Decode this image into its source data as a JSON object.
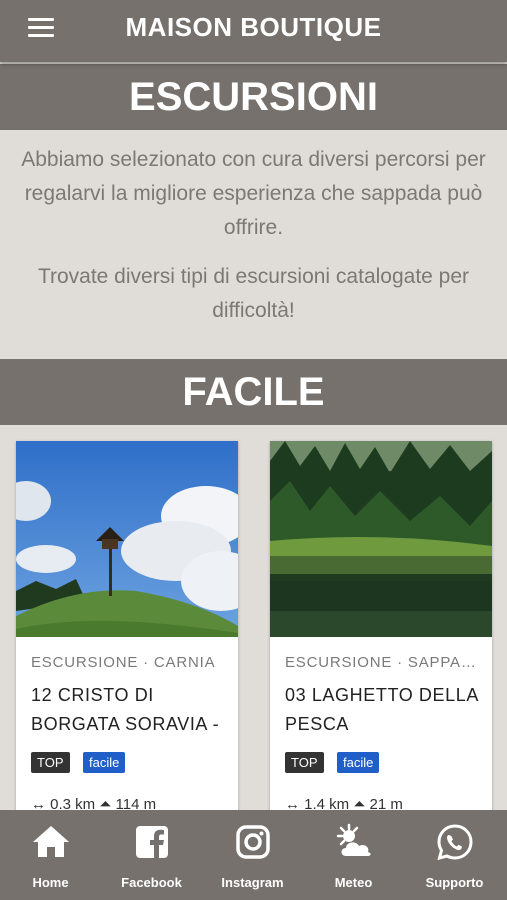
{
  "header": {
    "title": "MAISON BOUTIQUE"
  },
  "section1": {
    "title": "ESCURSIONI",
    "paragraph1": "Abbiamo selezionato con cura diversi percorsi per regalarvi la migliore esperienza che sappada può offrire.",
    "paragraph2": "Trovate diversi tipi di escursioni catalogate per difficoltà!"
  },
  "section2": {
    "title": "FACILE"
  },
  "cards": [
    {
      "meta": "ESCURSIONE · CARNIA",
      "title": "12 CRISTO DI BORGATA SORAVIA -",
      "badge_top": "TOP",
      "badge_difficulty": "facile",
      "stats": "↔ 0.3 km   ⏶ 114 m"
    },
    {
      "meta": "ESCURSIONE · SAPPADA",
      "title": "03 LAGHETTO DELLA PESCA",
      "badge_top": "TOP",
      "badge_difficulty": "facile",
      "stats": "↔ 1.4 km   ⏶ 21 m"
    }
  ],
  "nav": [
    {
      "label": "Home",
      "icon": "home-icon"
    },
    {
      "label": "Facebook",
      "icon": "facebook-icon"
    },
    {
      "label": "Instagram",
      "icon": "instagram-icon"
    },
    {
      "label": "Meteo",
      "icon": "weather-icon"
    },
    {
      "label": "Supporto",
      "icon": "whatsapp-icon"
    }
  ],
  "colors": {
    "bar": "#76716c",
    "background": "#e0dcd8",
    "badge_top": "#333333",
    "badge_difficulty": "#1f5fc7"
  }
}
